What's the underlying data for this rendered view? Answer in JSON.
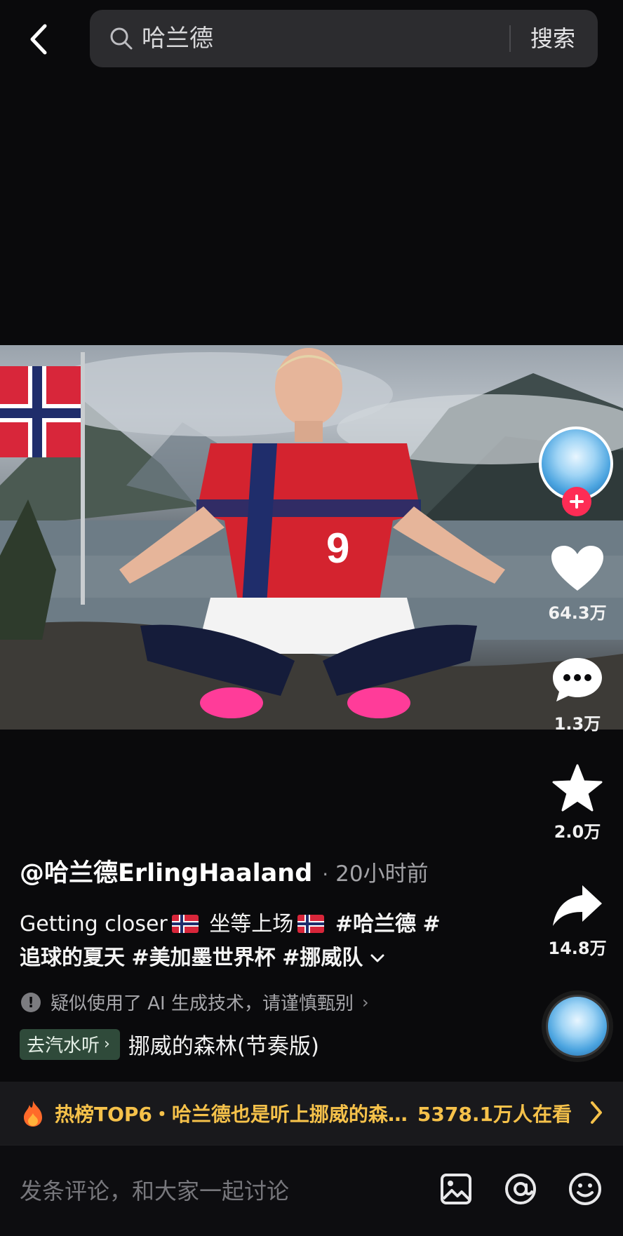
{
  "search": {
    "query": "哈兰德",
    "button_label": "搜索"
  },
  "video": {
    "description": "Player seated cross-legged in red Norway kit by a fjord with Norwegian flag"
  },
  "actions": {
    "likes": "64.3万",
    "comments": "1.3万",
    "favorites": "2.0万",
    "shares": "14.8万"
  },
  "post": {
    "author": "@哈兰德ErlingHaaland",
    "time": "20小时前",
    "desc_part1": "Getting closer",
    "desc_part2": "坐等上场",
    "tag1": "#哈兰德",
    "tag2_start": "#",
    "tag2_rest": "追球的夏天",
    "tag3": "#美加墨世界杯",
    "tag4": "#挪威队"
  },
  "ai_note": "疑似使用了 AI 生成技术，请谨慎甄别",
  "music": {
    "tag_label": "去汽水听",
    "title": "挪威的森林(节奏版)"
  },
  "hot": {
    "text": "热榜TOP6・哈兰德也是听上挪威的森…",
    "count": "5378.1万人在看"
  },
  "comment": {
    "placeholder": "发条评论，和大家一起讨论"
  },
  "colors": {
    "accent_pink": "#fe2c55",
    "hot_gold": "#f5c14a",
    "music_tag_bg": "#2f4a3a"
  },
  "icons": [
    "back-icon",
    "search-icon",
    "heart-icon",
    "comment-icon",
    "star-icon",
    "share-icon",
    "fire-icon",
    "image-icon",
    "at-icon",
    "emoji-icon",
    "plus-icon"
  ]
}
